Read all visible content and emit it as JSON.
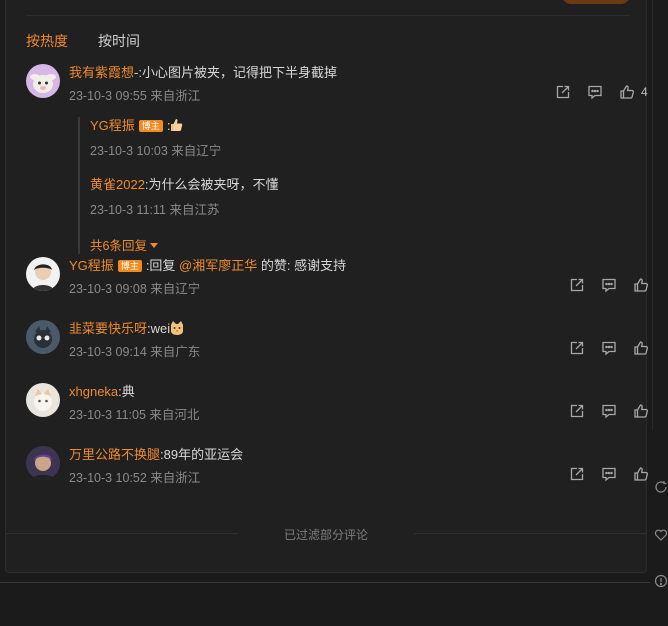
{
  "tabs": {
    "hot": "按热度",
    "time": "按时间"
  },
  "comments": [
    {
      "user": "我有紫霞想",
      "text": "-:小心图片被夹，记得把下半身截掉",
      "meta": "23-10-3 09:55 来自浙江",
      "likes": "4",
      "replies": [
        {
          "user": "YG程振",
          "badge": "博主",
          "text": ":",
          "meta": "23-10-3 10:03 来自辽宁"
        },
        {
          "user": "黄雀2022",
          "text": ":为什么会被夹呀，不懂",
          "meta": "23-10-3 11:11 来自江苏"
        }
      ],
      "more": "共6条回复"
    },
    {
      "user": "YG程振",
      "badge": "博主",
      "text_prefix": ":回复 ",
      "mention": "@湘军廖正华",
      "text_suffix": " 的赞: 感谢支持",
      "meta": "23-10-3 09:08 来自辽宁"
    },
    {
      "user": "韭菜要快乐呀",
      "text": ":wei",
      "meta": "23-10-3 09:14 来自广东"
    },
    {
      "user": "xhgneka",
      "text": ":典",
      "meta": "23-10-3 11:05 来自河北"
    },
    {
      "user": "万里公路不换腿",
      "text": ":89年的亚运会",
      "meta": "23-10-3 10:52 来自浙江"
    }
  ],
  "filter_note": "已过滤部分评论",
  "colors": {
    "accent": "#ee8a2f",
    "background": "#202020",
    "meta": "#8a8a8a"
  },
  "icons": [
    "share-icon",
    "comment-icon",
    "like-icon",
    "thumbs-up-emoji",
    "cat-emoji",
    "caret-down-icon"
  ]
}
